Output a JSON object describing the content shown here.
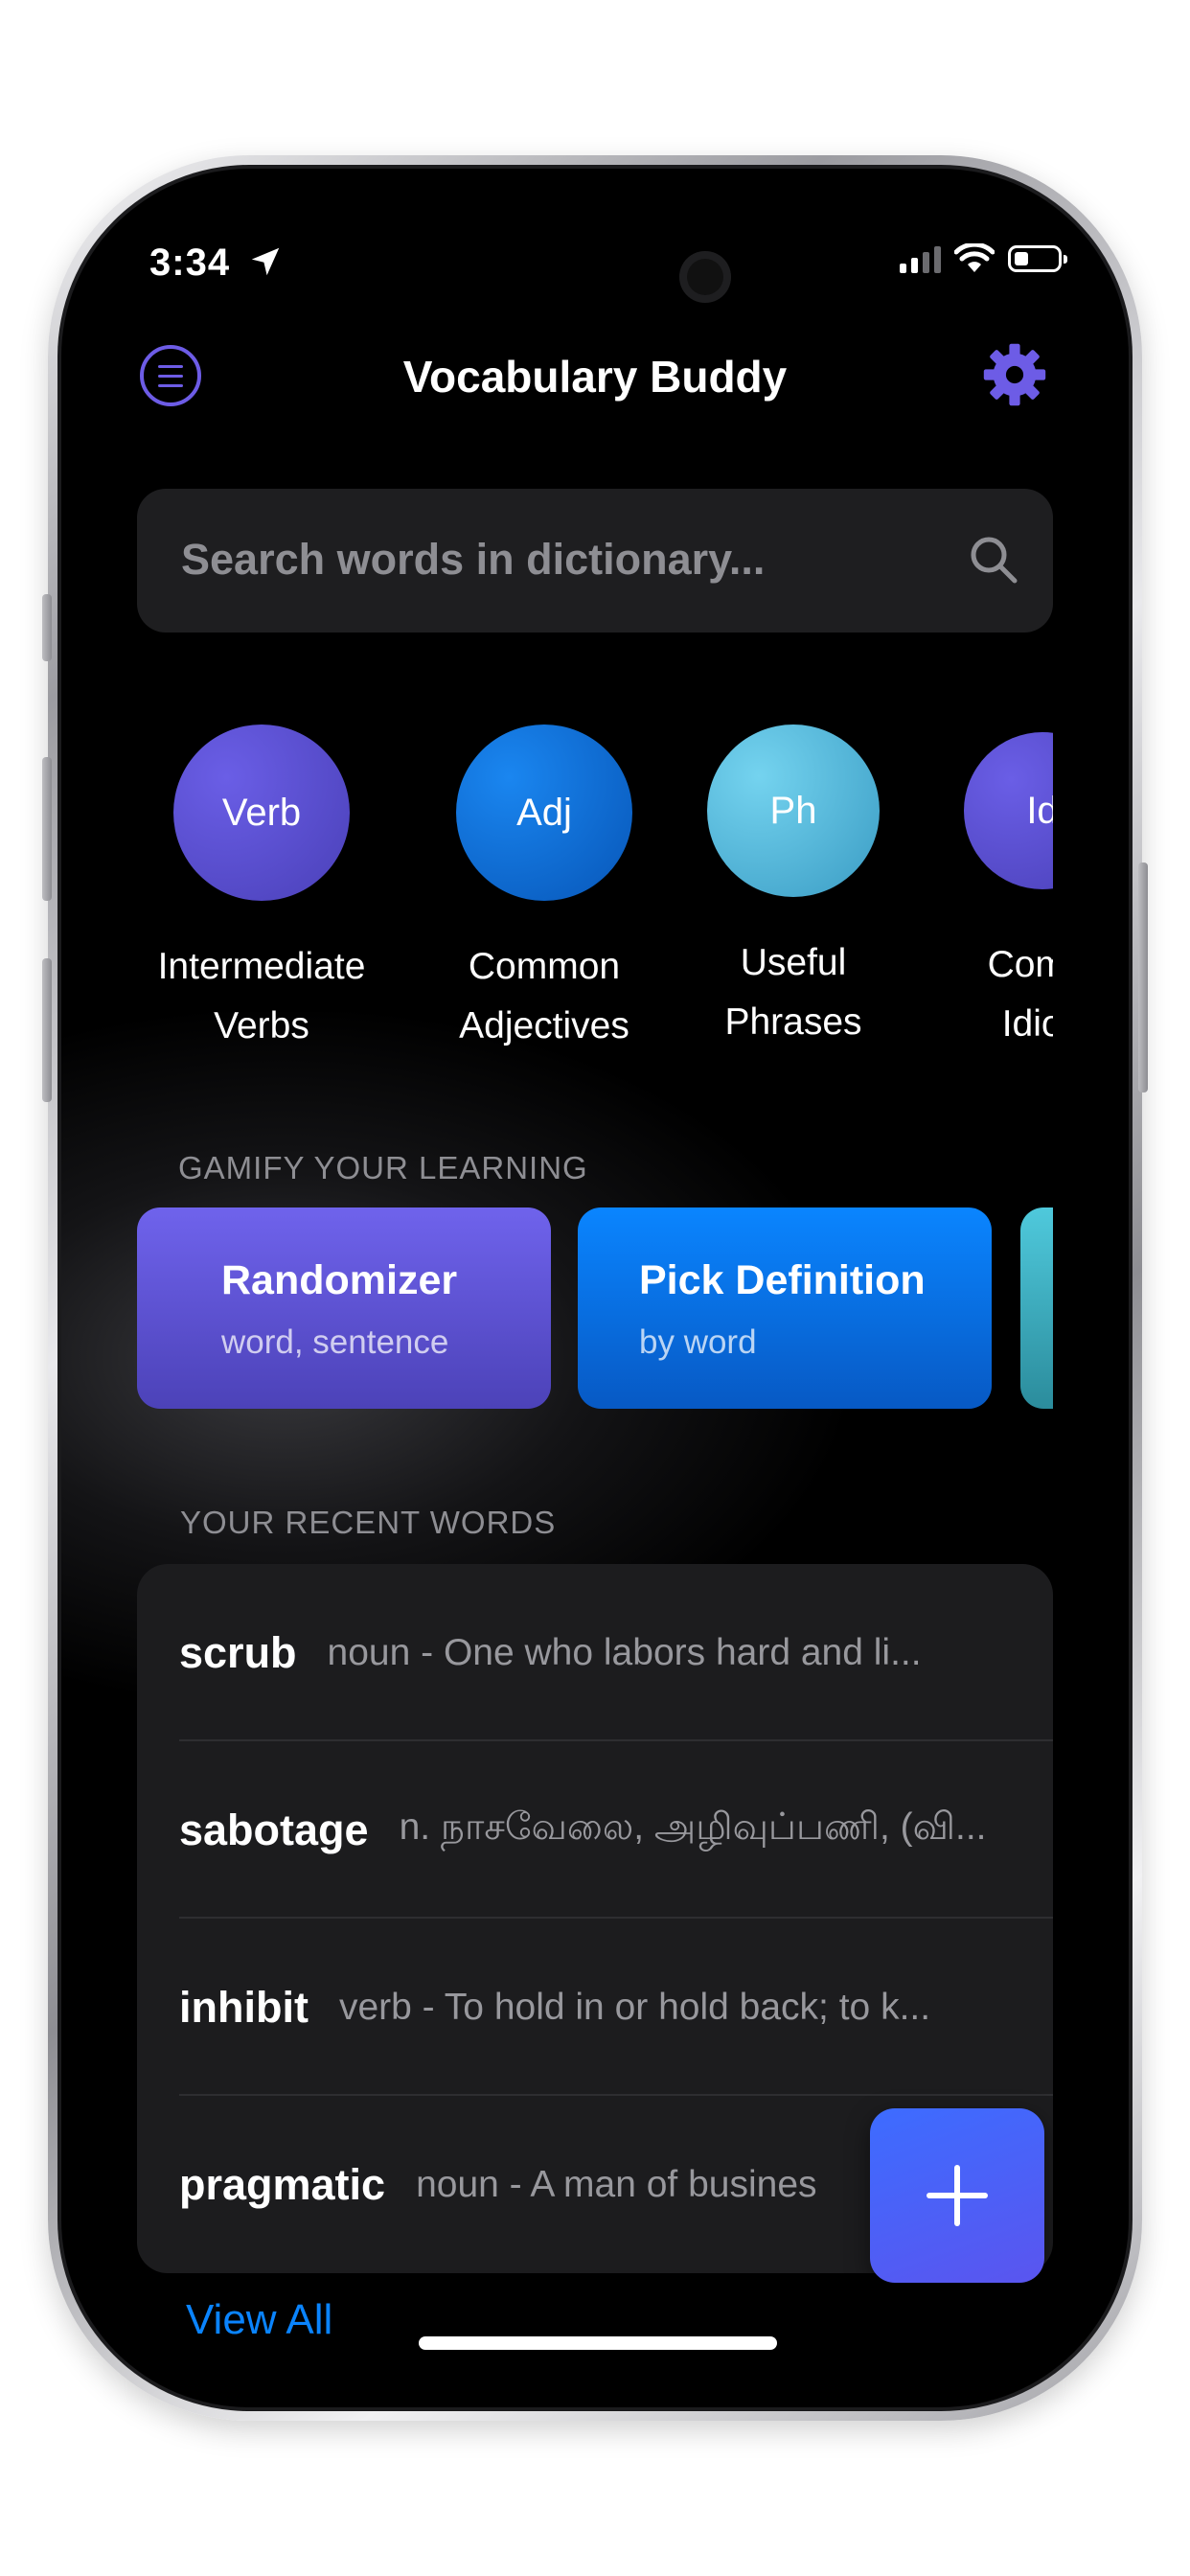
{
  "status_bar": {
    "time": "3:34"
  },
  "header": {
    "title": "Vocabulary Buddy"
  },
  "search": {
    "placeholder": "Search words in dictionary..."
  },
  "categories": [
    {
      "abbr": "Verb",
      "line1": "Intermediate",
      "line2": "Verbs",
      "color": "#5b4fd6"
    },
    {
      "abbr": "Adj",
      "line1": "Common",
      "line2": "Adjectives",
      "color": "#0a6fe0"
    },
    {
      "abbr": "Ph",
      "line1": "Useful",
      "line2": "Phrases",
      "color": "#59c3e6"
    },
    {
      "abbr": "Id",
      "line1": "Comm",
      "line2": "Idion",
      "color": "#5b4fd6"
    }
  ],
  "gamify": {
    "title": "GAMIFY YOUR LEARNING",
    "cards": [
      {
        "title": "Randomizer",
        "subtitle": "word, sentence",
        "color": "#6a5de9"
      },
      {
        "title": "Pick Definition",
        "subtitle": "by word",
        "color": "#0a7cf2"
      }
    ]
  },
  "recent": {
    "title": "YOUR RECENT WORDS",
    "words": [
      {
        "word": "scrub",
        "def": "noun -  One who labors hard and li..."
      },
      {
        "word": "sabotage",
        "def": "n. நாசவேலை, அழிவுப்பணி, (வி..."
      },
      {
        "word": "inhibit",
        "def": "verb -  To hold in or hold back; to k..."
      },
      {
        "word": "pragmatic",
        "def": "noun -  A man of busines"
      }
    ],
    "view_all": "View All"
  },
  "icons": {
    "menu": "menu-icon",
    "settings": "gear-icon",
    "search": "search-icon",
    "add": "plus-icon",
    "location": "location-arrow-icon",
    "signal": "cellular-signal-icon",
    "wifi": "wifi-icon",
    "battery": "battery-icon"
  },
  "colors": {
    "accent": "#6d5ce6",
    "link": "#0a84ff",
    "background": "#000000",
    "card": "#1c1c1e"
  }
}
